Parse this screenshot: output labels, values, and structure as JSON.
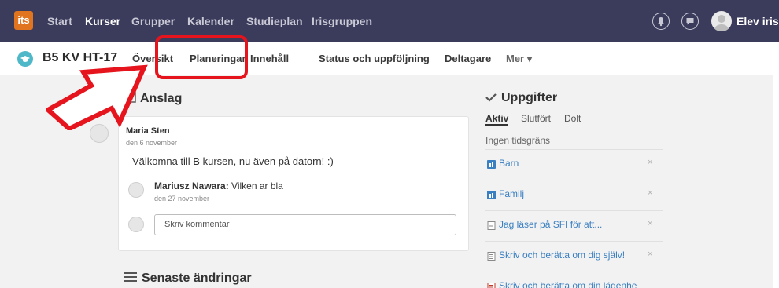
{
  "topnav": {
    "logo": "its",
    "items": [
      "Start",
      "Kurser",
      "Grupper",
      "Kalender",
      "Studieplan",
      "Irisgruppen"
    ],
    "user": "Elev iris"
  },
  "course": {
    "title": "B5 KV HT-17",
    "tabs": [
      "Översikt",
      "Planeringar",
      "Innehåll",
      "Status och uppföljning",
      "Deltagare",
      "Mer ▾"
    ]
  },
  "announcements": {
    "heading": "Anslag",
    "post": {
      "author": "Maria Sten",
      "date": "den 6 november",
      "body": "Välkomna till B kursen, nu även på datorn! :)"
    },
    "comment": {
      "author": "Mariusz Nawara:",
      "text": " Vilken ar bla",
      "date": "den 27 november"
    },
    "comment_placeholder": "Skriv kommentar"
  },
  "recent": {
    "heading": "Senaste ändringar"
  },
  "tasks": {
    "heading": "Uppgifter",
    "tabs": [
      "Aktiv",
      "Slutfört",
      "Dolt"
    ],
    "subheading": "Ingen tidsgräns",
    "items": [
      {
        "label": "Barn",
        "close": "×",
        "icon": "blue-task-icon"
      },
      {
        "label": "Familj",
        "close": "×",
        "icon": "blue-task-icon"
      },
      {
        "label": "Jag läser på SFI för att...",
        "close": "×",
        "icon": "document-icon"
      },
      {
        "label": "Skriv och berätta om dig själv!",
        "close": "×",
        "icon": "document-icon"
      },
      {
        "label": "Skriv och berätta om din lägenhe",
        "close": "",
        "icon": "document-icon"
      }
    ]
  },
  "colors": {
    "nav_bg": "#3b3b5c",
    "link": "#3a7fc1",
    "annotation": "#e5141d",
    "logo": "#e0741f"
  }
}
